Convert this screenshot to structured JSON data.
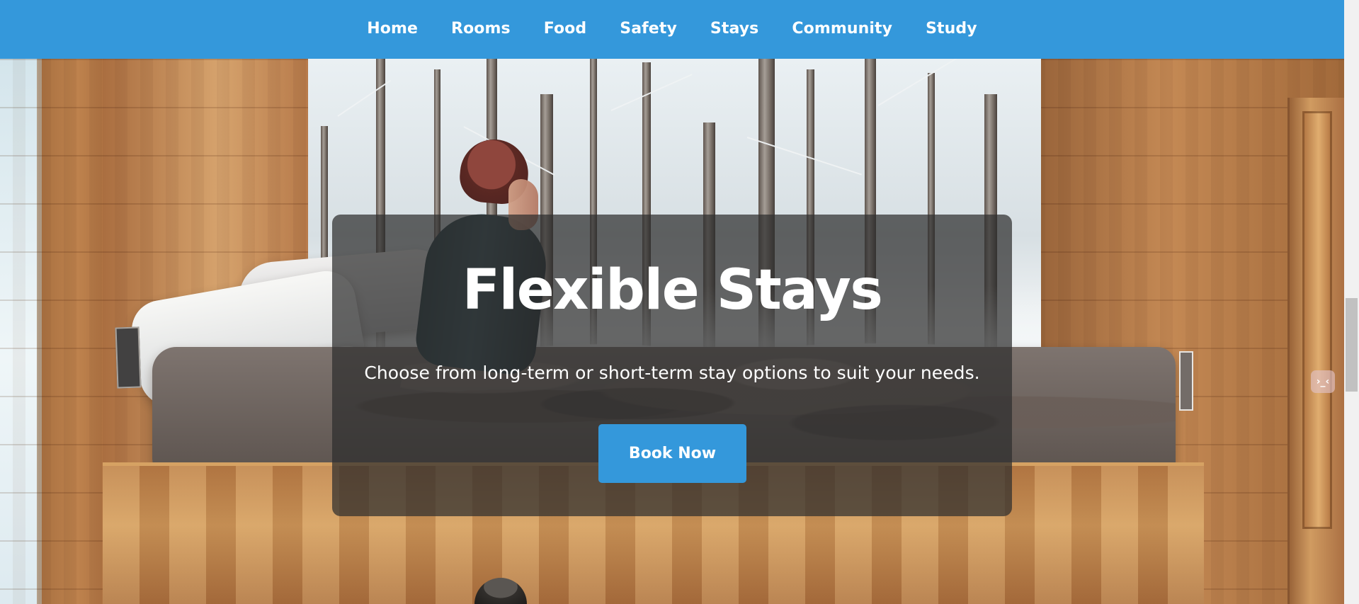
{
  "navigation": {
    "items": [
      {
        "label": "Home"
      },
      {
        "label": "Rooms"
      },
      {
        "label": "Food"
      },
      {
        "label": "Safety"
      },
      {
        "label": "Stays"
      },
      {
        "label": "Community"
      },
      {
        "label": "Study"
      }
    ]
  },
  "hero": {
    "title": "Flexible Stays",
    "subtitle": "Choose from long-term or short-term stay options to suit your needs.",
    "button_label": "Book Now",
    "background_image": "cozy-wooden-cabin-bedroom-with-snowy-forest-view"
  },
  "side_toggle": {
    "label": "›_‹"
  },
  "colors": {
    "brand_blue": "#3498db",
    "text_white": "#ffffff",
    "overlay_dark": "#2e2e2e"
  },
  "icons": {
    "side_toggle": "terminal-toggle-icon"
  }
}
